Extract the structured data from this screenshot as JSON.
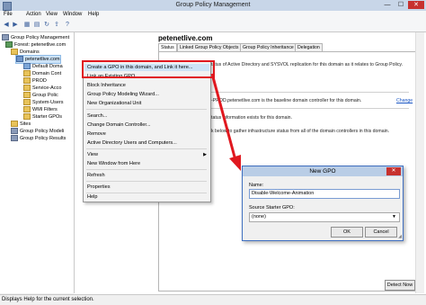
{
  "window": {
    "title": "Group Policy Management",
    "min": "—",
    "max": "☐",
    "close": "✕"
  },
  "menubar": [
    "File",
    "Action",
    "View",
    "Window",
    "Help"
  ],
  "tree": {
    "root": "Group Policy Management",
    "forest": "Forest: petenetlive.com",
    "domains": "Domains",
    "domain": "petenetlive.com",
    "items": [
      "Default Doma",
      "Domain Cont",
      "PROD",
      "Service-Acco",
      "Group Polic",
      "System-Users",
      "WMI Filters",
      "Starter GPOs"
    ],
    "sites": "Sites",
    "modeling": "Group Policy Modeli",
    "results": "Group Policy Results"
  },
  "right": {
    "domain_header": "petenetlive.com",
    "tabs": [
      "Status",
      "Linked Group Policy Objects",
      "Group Policy Inheritance",
      "Delegation"
    ],
    "text1": "tatus of Active Directory and SYSVOL replication for this domain as it relates to Group Policy.",
    "text2": "-PROD.petenetlive.com is the baseline domain controller for this domain.",
    "change_link": "Change",
    "text3": "tatus information exists for this domain.",
    "text4": "k below to gather infrastructure status from all of the domain controllers in this domain.",
    "detect_button": "Detect Now"
  },
  "context_menu": {
    "items": [
      "Create a GPO in this domain, and Link it here...",
      "Link an Existing GPO...",
      "Block Inheritance",
      "Group Policy Modeling Wizard...",
      "New Organizational Unit",
      "Search...",
      "Change Domain Controller...",
      "Remove",
      "Active Directory Users and Computers...",
      "View",
      "New Window from Here",
      "Refresh",
      "Properties",
      "Help"
    ],
    "submenu_arrow": "▶"
  },
  "dialog": {
    "title": "New GPO",
    "name_label": "Name:",
    "name_value": "Disable-Welcome-Animation",
    "starter_label": "Source Starter GPO:",
    "starter_value": "(none)",
    "ok": "OK",
    "cancel": "Cancel",
    "close": "✕"
  },
  "statusbar": "Displays Help for the current selection.",
  "colors": {
    "annotation_red": "#e0181f",
    "selection_blue": "#cde3f7",
    "dialog_border": "#3f6fc0"
  }
}
